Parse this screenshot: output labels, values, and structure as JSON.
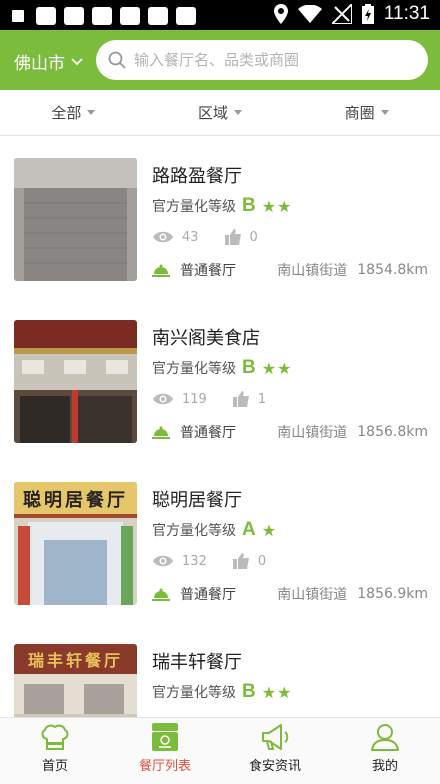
{
  "status_bar": {
    "time": "11:31"
  },
  "header": {
    "city": "佛山市",
    "search_placeholder": "输入餐厅名、品类或商圈"
  },
  "filters": [
    {
      "label": "全部"
    },
    {
      "label": "区域"
    },
    {
      "label": "商圈"
    }
  ],
  "restaurants": [
    {
      "name": "路路盈餐厅",
      "grade_label": "官方量化等级",
      "grade": "B",
      "stars": "★★",
      "views": "43",
      "likes": "0",
      "type": "普通餐厅",
      "area": "南山镇街道",
      "distance": "1854.8km"
    },
    {
      "name": "南兴阁美食店",
      "grade_label": "官方量化等级",
      "grade": "B",
      "stars": "★★",
      "views": "119",
      "likes": "1",
      "type": "普通餐厅",
      "area": "南山镇街道",
      "distance": "1856.8km"
    },
    {
      "name": "聪明居餐厅",
      "grade_label": "官方量化等级",
      "grade": "A",
      "stars": "★",
      "views": "132",
      "likes": "0",
      "type": "普通餐厅",
      "area": "南山镇街道",
      "distance": "1856.9km",
      "sign_text": "聪明居餐厅"
    },
    {
      "name": "瑞丰轩餐厅",
      "grade_label": "官方量化等级",
      "grade": "B",
      "stars": "★★",
      "views": "",
      "likes": "",
      "type": "",
      "area": "",
      "distance": "",
      "sign_text": "瑞丰轩餐厅"
    }
  ],
  "bottom_nav": [
    {
      "label": "首页",
      "icon": "chef-hat-icon"
    },
    {
      "label": "餐厅列表",
      "icon": "storefront-icon",
      "active": true
    },
    {
      "label": "食安资讯",
      "icon": "megaphone-icon"
    },
    {
      "label": "我的",
      "icon": "user-icon"
    }
  ],
  "colors": {
    "brand": "#7cbc3c",
    "active_tab": "#e24d3b"
  }
}
